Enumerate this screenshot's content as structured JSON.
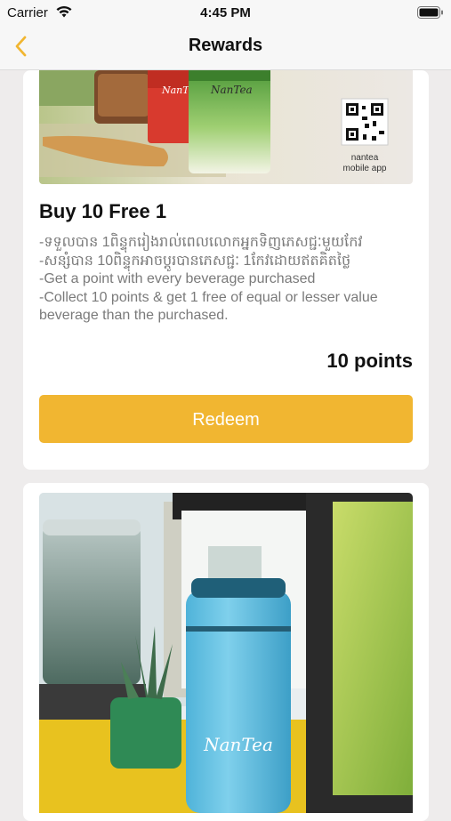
{
  "status_bar": {
    "carrier": "Carrier",
    "time": "4:45 PM"
  },
  "nav": {
    "title": "Rewards",
    "back_icon": "chevron-left-icon",
    "accent": "#f1b631"
  },
  "rewards": [
    {
      "banner_brand": "NanTea",
      "qr_caption_line1": "nantea",
      "qr_caption_line2": "mobile app",
      "title": "Buy 10 Free 1",
      "description": [
        "-ទទួលបាន 1ពិន្ទុករៀងរាល់ពេលលោកអ្នកទិញភេសជ្ជៈមួយកែវ",
        "-សន្សំបាន 10ពិន្ទុកអាចប្ដូរបានភេសជ្ជៈ 1កែវដោយឥតគិតថ្លៃ",
        "-Get a point with every beverage purchased",
        "-Collect 10 points & get 1 free of equal or lesser value",
        "beverage than the purchased."
      ],
      "points": "10 points",
      "redeem_label": "Redeem"
    },
    {
      "banner_brand": "NanTea"
    }
  ]
}
